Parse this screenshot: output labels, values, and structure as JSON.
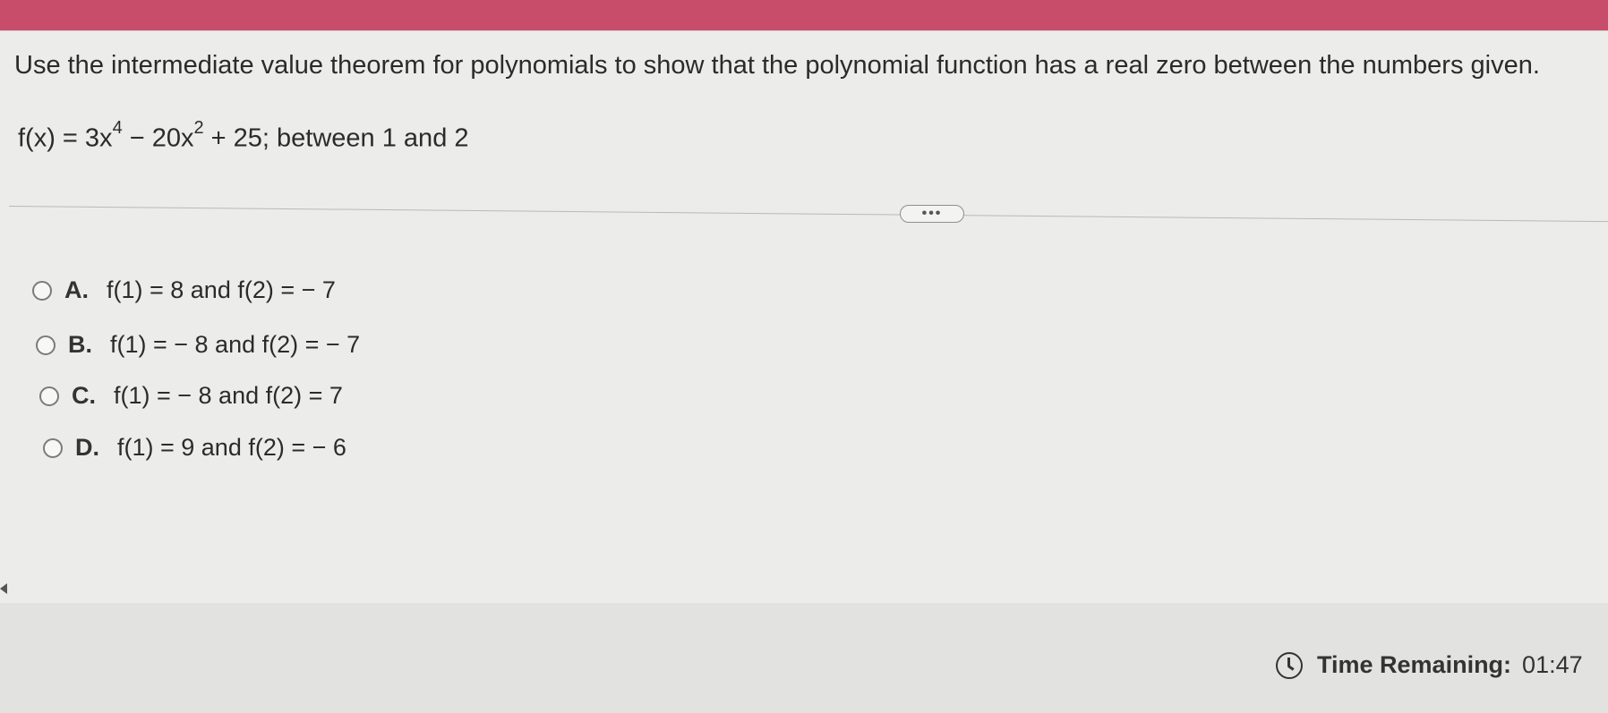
{
  "question": {
    "prompt": "Use the intermediate value theorem for polynomials to show that the polynomial function has a real zero between the numbers given.",
    "formula_prefix": "f(x) = 3x",
    "exp1": "4",
    "formula_mid": " − 20x",
    "exp2": "2",
    "formula_suffix": " + 25; between 1 and 2"
  },
  "more_button": {
    "label": "•••"
  },
  "options": [
    {
      "letter": "A.",
      "text": "f(1) = 8 and f(2) = − 7"
    },
    {
      "letter": "B.",
      "text": "f(1) = − 8 and f(2) = − 7"
    },
    {
      "letter": "C.",
      "text": "f(1) = − 8 and f(2) = 7"
    },
    {
      "letter": "D.",
      "text": "f(1) = 9 and f(2) = − 6"
    }
  ],
  "timer": {
    "label": "Time Remaining:",
    "value": "01:47"
  },
  "colors": {
    "top_bar": "#c84d6b"
  }
}
